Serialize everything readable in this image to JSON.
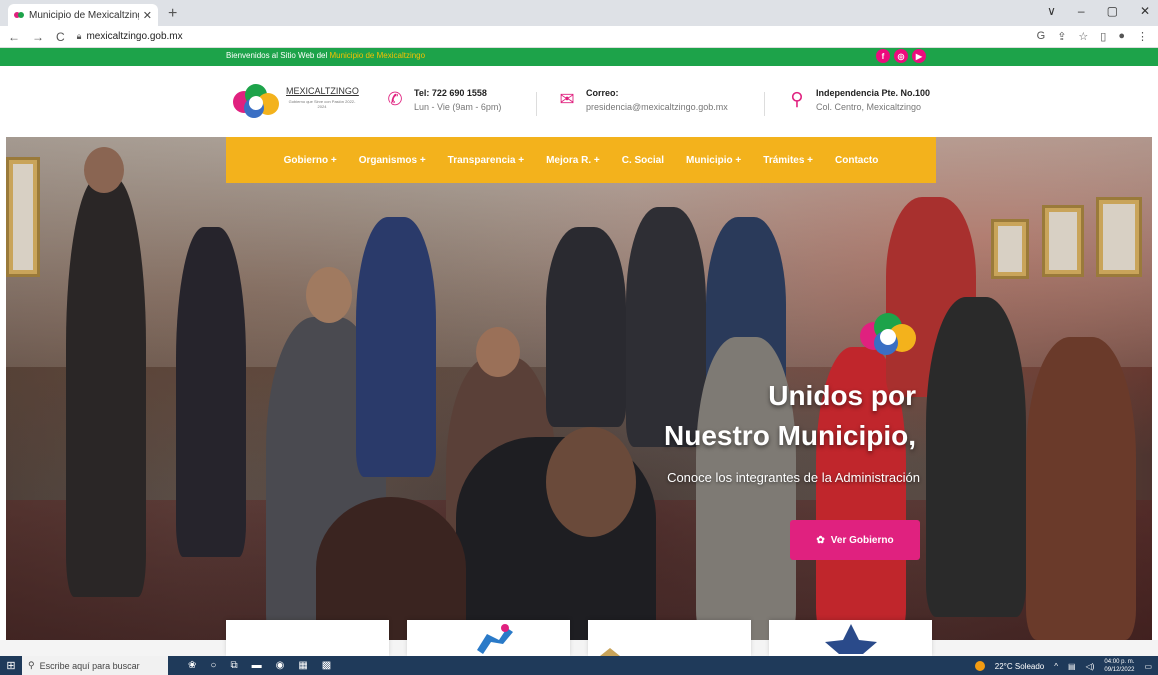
{
  "browser": {
    "tab_title": "Municipio de Mexicaltzingo – Ad",
    "new_tab": "+",
    "url": "mexicaltzingo.gob.mx",
    "win_controls": [
      "∨",
      "–",
      "▢",
      "✕"
    ]
  },
  "topbar": {
    "welcome_prefix": "Bienvenidos al Sitio Web del ",
    "welcome_highlight": "Municipio de Mexicaltzingo",
    "social": [
      "f",
      "◎",
      "▶"
    ]
  },
  "header": {
    "brand_name": "MEXICALTZINGO",
    "brand_sub": "Gobierno que Sirve con Pasión 2022-2024",
    "phone_title": "Tel: 722 690 1558",
    "phone_sub": "Lun - Vie (9am - 6pm)",
    "mail_title": "Correo:",
    "mail_sub": "presidencia@mexicaltzingo.gob.mx",
    "addr_title": "Independencia Pte. No.100",
    "addr_sub": "Col. Centro, Mexicaltzingo"
  },
  "menu": [
    "Gobierno +",
    "Organismos +",
    "Transparencia +",
    "Mejora R. +",
    "C. Social",
    "Municipio +",
    "Trámites +",
    "Contacto"
  ],
  "hero": {
    "title_line1": "Unidos por",
    "title_line2": "Nuestro Municipio,",
    "subtitle": "Conoce los integrantes de la Administración",
    "button": "Ver Gobierno"
  },
  "taskbar": {
    "search_placeholder": "Escribe aquí para buscar",
    "weather": "22°C Soleado",
    "time": "04:00 p. m.",
    "date": "09/12/2022"
  },
  "colors": {
    "green": "#1da34a",
    "yellow": "#f3b21c",
    "pink": "#e0217f"
  }
}
